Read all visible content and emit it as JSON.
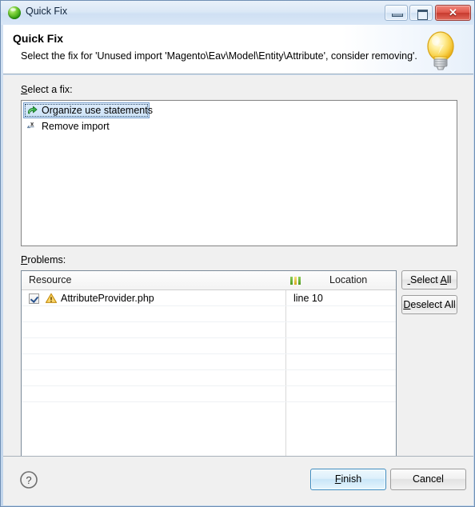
{
  "window": {
    "title": "Quick Fix",
    "icon": "green-sphere-icon",
    "controls": {
      "minimize": "minimize-button",
      "maximize": "maximize-button",
      "close_glyph": "✕"
    }
  },
  "header": {
    "title": "Quick Fix",
    "description": "Select the fix for 'Unused import 'Magento\\Eav\\Model\\Entity\\Attribute', consider removing'.",
    "banner_icon": "lightbulb-icon"
  },
  "fix_section": {
    "label": "Select a fix:",
    "label_mnemonic": "S",
    "items": [
      {
        "label": "Organize use statements",
        "icon": "organize-imports-icon",
        "selected": true
      },
      {
        "label": "Remove import",
        "icon": "remove-import-icon",
        "selected": false
      }
    ]
  },
  "problems_section": {
    "label": "Problems:",
    "label_mnemonic": "P",
    "columns": [
      {
        "label": "Resource"
      },
      {
        "label": "Location",
        "icon": "severity-bars-icon"
      }
    ],
    "rows": [
      {
        "checked": true,
        "severity_icon": "warning-icon",
        "resource": "AttributeProvider.php",
        "location": "line 10"
      }
    ],
    "empty_row_count": 6,
    "buttons": {
      "select_all": "Select All",
      "select_all_mnemonic": "A",
      "deselect_all": "Deselect All",
      "deselect_all_mnemonic": "D"
    }
  },
  "footer": {
    "help_icon": "help-icon",
    "help_glyph": "?",
    "finish": "Finish",
    "finish_mnemonic": "F",
    "cancel": "Cancel",
    "default_button": "Finish"
  },
  "colors": {
    "selection_blue": "#cde3f8",
    "selection_border": "#7da2ce",
    "warning_amber": "#f0b428",
    "default_button_border": "#3c8bbf",
    "title_icon_green": "#2f9e11",
    "dialog_background": "#f0f0f0"
  }
}
